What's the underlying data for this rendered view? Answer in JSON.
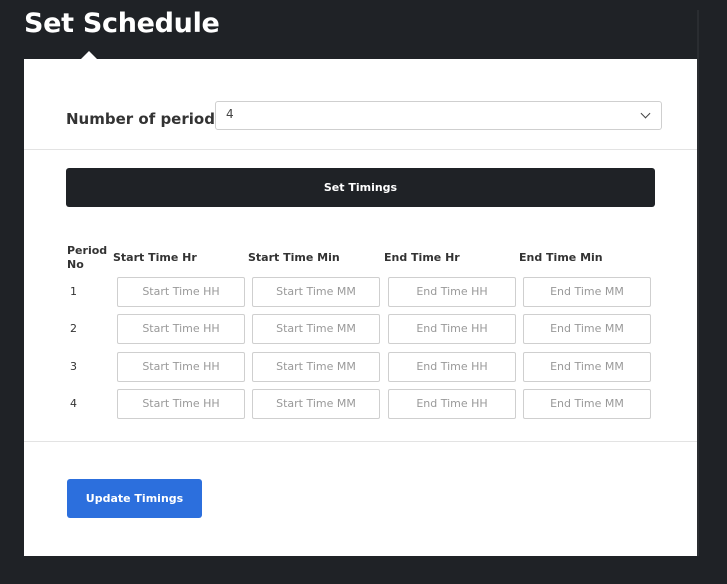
{
  "page": {
    "title": "Set Schedule"
  },
  "periods": {
    "label": "Number of periods",
    "value": "4"
  },
  "set_timings_label": "Set Timings",
  "table": {
    "headers": [
      "Period No",
      "Start Time Hr",
      "Start Time Min",
      "End Time Hr",
      "End Time Min"
    ],
    "period_no_header_lines": [
      "Period",
      "No"
    ],
    "rows": [
      {
        "no": "1"
      },
      {
        "no": "2"
      },
      {
        "no": "3"
      },
      {
        "no": "4"
      }
    ],
    "placeholders": [
      "Start Time HH",
      "Start Time MM",
      "End Time HH",
      "End Time MM"
    ]
  },
  "update_timings_label": "Update Timings",
  "colors": {
    "dark": "#1f2226",
    "primary": "#2c6fdd",
    "white": "#ffffff"
  }
}
